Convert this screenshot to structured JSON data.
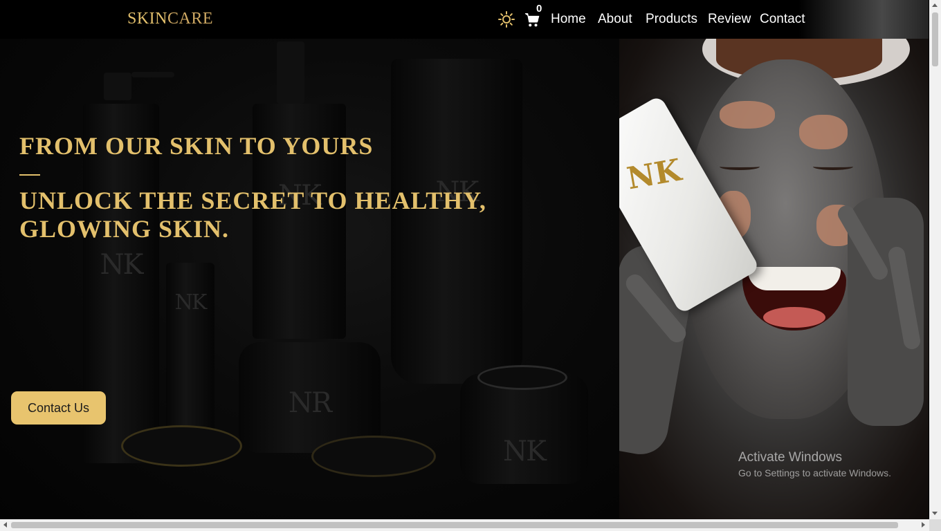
{
  "header": {
    "logo_part1": "SKIN",
    "logo_part2": "CARE",
    "cart_count": "0",
    "nav": [
      "Home",
      "About",
      "Products",
      "Review",
      "Contact"
    ]
  },
  "hero": {
    "headline": "FROM OUR SKIN TO YOURS",
    "subheadline": "UNLOCK THE SECRET TO HEALTHY, GLOWING SKIN.",
    "cta_label": "Contact Us"
  },
  "watermark": {
    "title": "Activate Windows",
    "subtitle": "Go to Settings to activate Windows."
  },
  "colors": {
    "accent": "#e3c06c",
    "button": "#e8c46e",
    "background": "#000000"
  },
  "icons": [
    "sun-icon",
    "cart-icon"
  ]
}
